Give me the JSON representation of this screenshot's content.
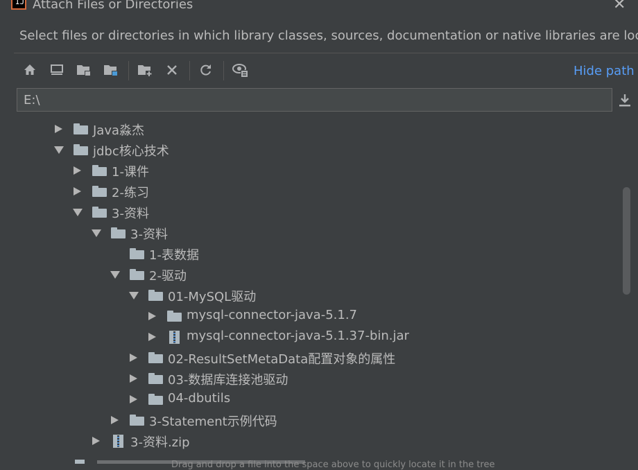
{
  "window": {
    "title": "Attach Files or Directories",
    "close_glyph": "✕"
  },
  "description": "Select files or directories in which library classes, sources, documentation or native libraries are located",
  "toolbar": {
    "buttons": [
      {
        "name": "home-icon"
      },
      {
        "name": "desktop-icon"
      },
      {
        "name": "project-folder-icon"
      },
      {
        "name": "module-folder-icon"
      },
      {
        "name": "new-folder-icon"
      },
      {
        "name": "delete-icon"
      },
      {
        "name": "refresh-icon"
      },
      {
        "name": "show-hidden-icon"
      }
    ],
    "hide_path": "Hide path"
  },
  "path": {
    "value": "E:\\"
  },
  "tree": {
    "items": [
      {
        "label": "Java淼杰",
        "depth": 0,
        "state": "collapsed",
        "kind": "folder"
      },
      {
        "label": "jdbc核心技术",
        "depth": 0,
        "state": "expanded",
        "kind": "folder"
      },
      {
        "label": "1-课件",
        "depth": 1,
        "state": "collapsed",
        "kind": "folder"
      },
      {
        "label": "2-练习",
        "depth": 1,
        "state": "collapsed",
        "kind": "folder"
      },
      {
        "label": "3-资料",
        "depth": 1,
        "state": "expanded",
        "kind": "folder"
      },
      {
        "label": "3-资料",
        "depth": 2,
        "state": "expanded",
        "kind": "folder"
      },
      {
        "label": "1-表数据",
        "depth": 3,
        "state": "leaf",
        "kind": "folder"
      },
      {
        "label": "2-驱动",
        "depth": 3,
        "state": "expanded",
        "kind": "folder"
      },
      {
        "label": "01-MySQL驱动",
        "depth": 4,
        "state": "expanded",
        "kind": "folder"
      },
      {
        "label": "mysql-connector-java-5.1.7",
        "depth": 5,
        "state": "collapsed",
        "kind": "folder"
      },
      {
        "label": "mysql-connector-java-5.1.37-bin.jar",
        "depth": 5,
        "state": "collapsed",
        "kind": "archive"
      },
      {
        "label": "02-ResultSetMetaData配置对象的属性",
        "depth": 4,
        "state": "collapsed",
        "kind": "folder"
      },
      {
        "label": "03-数据库连接池驱动",
        "depth": 4,
        "state": "collapsed",
        "kind": "folder"
      },
      {
        "label": "04-dbutils",
        "depth": 4,
        "state": "collapsed",
        "kind": "folder"
      },
      {
        "label": "3-Statement示例代码",
        "depth": 3,
        "state": "collapsed",
        "kind": "folder"
      },
      {
        "label": "3-资料.zip",
        "depth": 2,
        "state": "collapsed",
        "kind": "archive"
      }
    ]
  },
  "footer": {
    "hint": "Drag and drop a file into the space above to quickly locate it in the tree"
  },
  "colors": {
    "background": "#3c3f41",
    "link": "#589df6",
    "folder": "#aeb9c0",
    "text": "#bbbbbb"
  }
}
